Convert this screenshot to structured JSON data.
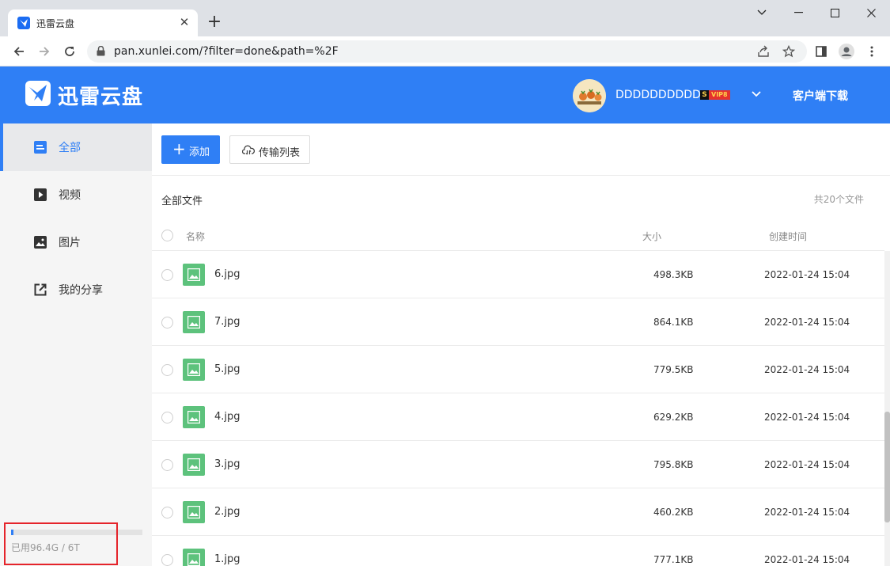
{
  "browser": {
    "tab_title": "迅雷云盘",
    "url": "pan.xunlei.com/?filter=done&path=%2F"
  },
  "header": {
    "logo_text": "迅雷云盘",
    "username": "DDDDDDDDDD",
    "vip_s": "S",
    "vip_tag": "VIP8",
    "download_client": "客户端下载",
    "accent_color": "#2f7ff5"
  },
  "sidebar": {
    "items": [
      {
        "label": "全部",
        "icon": "all-files-icon",
        "active": true
      },
      {
        "label": "视频",
        "icon": "video-icon",
        "active": false
      },
      {
        "label": "图片",
        "icon": "image-icon",
        "active": false
      },
      {
        "label": "我的分享",
        "icon": "share-icon",
        "active": false
      }
    ],
    "storage": {
      "text": "已用96.4G / 6T",
      "used_fraction": 0.0157
    }
  },
  "toolbar": {
    "add_label": "添加",
    "transfer_label": "传输列表"
  },
  "main": {
    "breadcrumb": "全部文件",
    "file_count": "共20个文件",
    "columns": {
      "name": "名称",
      "size": "大小",
      "created": "创建时间"
    },
    "files": [
      {
        "name": "6.jpg",
        "size": "498.3KB",
        "created": "2022-01-24 15:04"
      },
      {
        "name": "7.jpg",
        "size": "864.1KB",
        "created": "2022-01-24 15:04"
      },
      {
        "name": "5.jpg",
        "size": "779.5KB",
        "created": "2022-01-24 15:04"
      },
      {
        "name": "4.jpg",
        "size": "629.2KB",
        "created": "2022-01-24 15:04"
      },
      {
        "name": "3.jpg",
        "size": "795.8KB",
        "created": "2022-01-24 15:04"
      },
      {
        "name": "2.jpg",
        "size": "460.2KB",
        "created": "2022-01-24 15:04"
      },
      {
        "name": "1.jpg",
        "size": "777.1KB",
        "created": "2022-01-24 15:04"
      }
    ]
  }
}
